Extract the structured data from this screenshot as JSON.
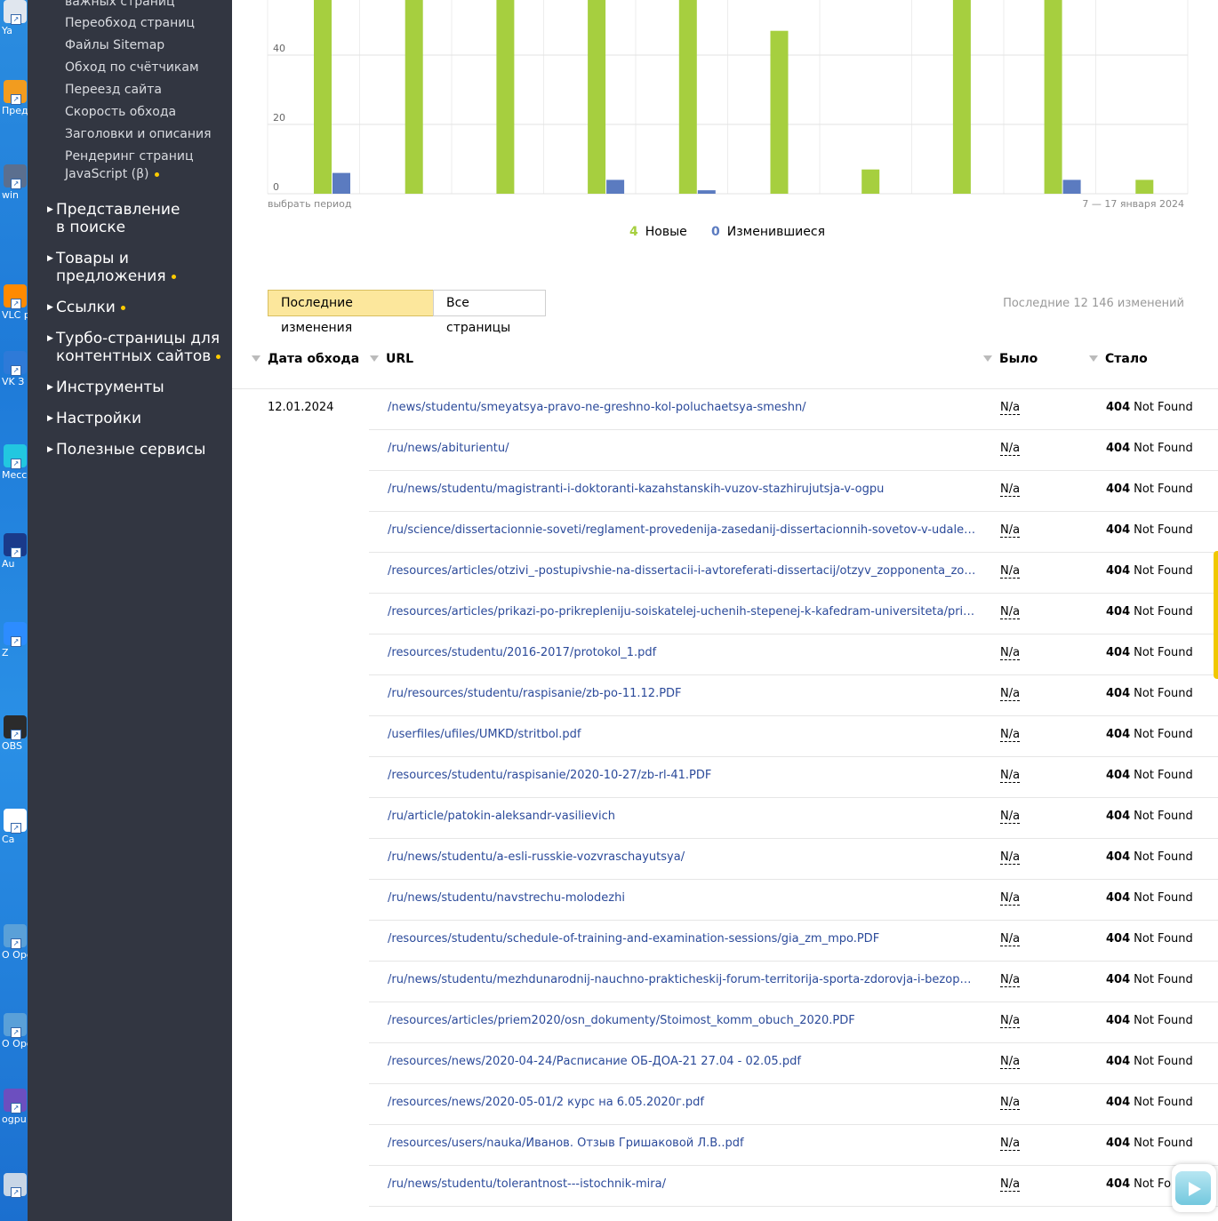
{
  "desktop": {
    "icons": [
      {
        "label": "Ya",
        "color": "#e0e6ee"
      },
      {
        "label": "Пред",
        "color": "#f29c1f"
      },
      {
        "label": "win",
        "color": "#5b6f8f"
      },
      {
        "label": "VLC pl",
        "color": "#ff8a00"
      },
      {
        "label": "VK З",
        "color": "#2e7ad8"
      },
      {
        "label": "Mecc",
        "color": "#22c7e0"
      },
      {
        "label": "Au",
        "color": "#1a3a8a"
      },
      {
        "label": "Z",
        "color": "#2d8cff"
      },
      {
        "label": "OBS",
        "color": "#2b2b2b"
      },
      {
        "label": "Ca",
        "color": "#ffffff"
      },
      {
        "label": "O Ope",
        "color": "#5aa0d8"
      },
      {
        "label": "O Ope",
        "color": "#5aa0d8"
      },
      {
        "label": "ogpu",
        "color": "#6c4fbf"
      },
      {
        "label": "",
        "color": "#c8d6e6"
      }
    ]
  },
  "sidebar": {
    "sub_items": [
      "важных страниц",
      "Переобход страниц",
      "Файлы Sitemap",
      "Обход по счётчикам",
      "Переезд сайта",
      "Скорость обхода",
      "Заголовки и описания",
      "Рендеринг страниц",
      "JavaScript (β)"
    ],
    "sections": [
      {
        "line1": "Представление",
        "line2": "в поиске"
      },
      {
        "line1": "Товары и",
        "line2": "предложения"
      },
      {
        "line1": "Ссылки",
        "line2": ""
      },
      {
        "line1": "Турбо-страницы для",
        "line2": "контентных сайтов"
      },
      {
        "line1": "Инструменты",
        "line2": ""
      },
      {
        "line1": "Настройки",
        "line2": ""
      },
      {
        "line1": "Полезные сервисы",
        "line2": ""
      }
    ]
  },
  "chart_data": {
    "type": "bar",
    "y_ticks": [
      "0",
      "20",
      "40"
    ],
    "ylim": [
      0,
      56
    ],
    "series": [
      {
        "name": "Новые",
        "color": "#a6cf3f",
        "values": [
          56,
          56,
          56,
          56,
          56,
          47,
          7,
          56,
          56,
          4
        ]
      },
      {
        "name": "Изменившиеся",
        "color": "#5b7bc0",
        "values": [
          6,
          0,
          0,
          4,
          1,
          0,
          0,
          0,
          4,
          0
        ]
      }
    ],
    "footer_left": "выбрать период",
    "footer_right": "7 — 17 января 2024",
    "grid": true
  },
  "legend": {
    "new_count": "4",
    "new_label": "Новые",
    "changed_count": "0",
    "changed_label": "Изменившиеся"
  },
  "tabs": {
    "recent": "Последние изменения",
    "all": "Все страницы"
  },
  "changes_count": "Последние 12 146 изменений",
  "table": {
    "headers": {
      "date": "Дата обхода",
      "url": "URL",
      "was": "Было",
      "now": "Стало"
    },
    "date": "12.01.2024",
    "was_value": "N/a",
    "status_code": "404",
    "status_text": "Not Found",
    "rows": [
      "/news/studentu/smeyatsya-pravo-ne-greshno-kol-poluchaetsya-smeshn/",
      "/ru/news/abiturientu/",
      "/ru/news/studentu/magistranti-i-doktoranti-kazahstanskih-vuzov-stazhirujutsja-v-ogpu",
      "/ru/science/dissertacionnie-soveti/reglament-provedenija-zasedanij-dissertacionnih-sovetov-v-udalennom-inter…",
      "/resources/articles/otzivi_-postupivshie-na-dissertacii-i-avtoreferati-dissertacij/otzyv_zopponenta_zotovoy_na_s…",
      "/resources/articles/prikazi-po-prikrepleniju-soiskatelej-uchenih-stepenej-k-kafedram-universiteta/prikaz_ob_otkr…",
      "/resources/studentu/2016-2017/protokol_1.pdf",
      "/ru/resources/studentu/raspisanie/zb-po-11.12.PDF",
      "/userfiles/ufiles/UMKD/stritbol.pdf",
      "/resources/studentu/raspisanie/2020-10-27/zb-rl-41.PDF",
      "/ru/article/patokin-aleksandr-vasilievich",
      "/ru/news/studentu/a-esli-russkie-vozvraschayutsya/",
      "/ru/news/studentu/navstrechu-molodezhi",
      "/resources/studentu/schedule-of-training-and-examination-sessions/gia_zm_mpo.PDF",
      "/ru/news/studentu/mezhdunarodnij-nauchno-prakticheskij-forum-territorija-sporta-zdorovja-i-bezopasnosti-zhi…",
      "/resources/articles/priem2020/osn_dokumenty/Stoimost_komm_obuch_2020.PDF",
      "/resources/news/2020-04-24/Расписание ОБ-ДОА-21 27.04 - 02.05.pdf",
      "/resources/news/2020-05-01/2 курс на 6.05.2020г.pdf",
      "/resources/users/nauka/Иванов. Отзыв Гришаковой Л.В..pdf",
      "/ru/news/studentu/tolerantnost---istochnik-mira/"
    ]
  }
}
